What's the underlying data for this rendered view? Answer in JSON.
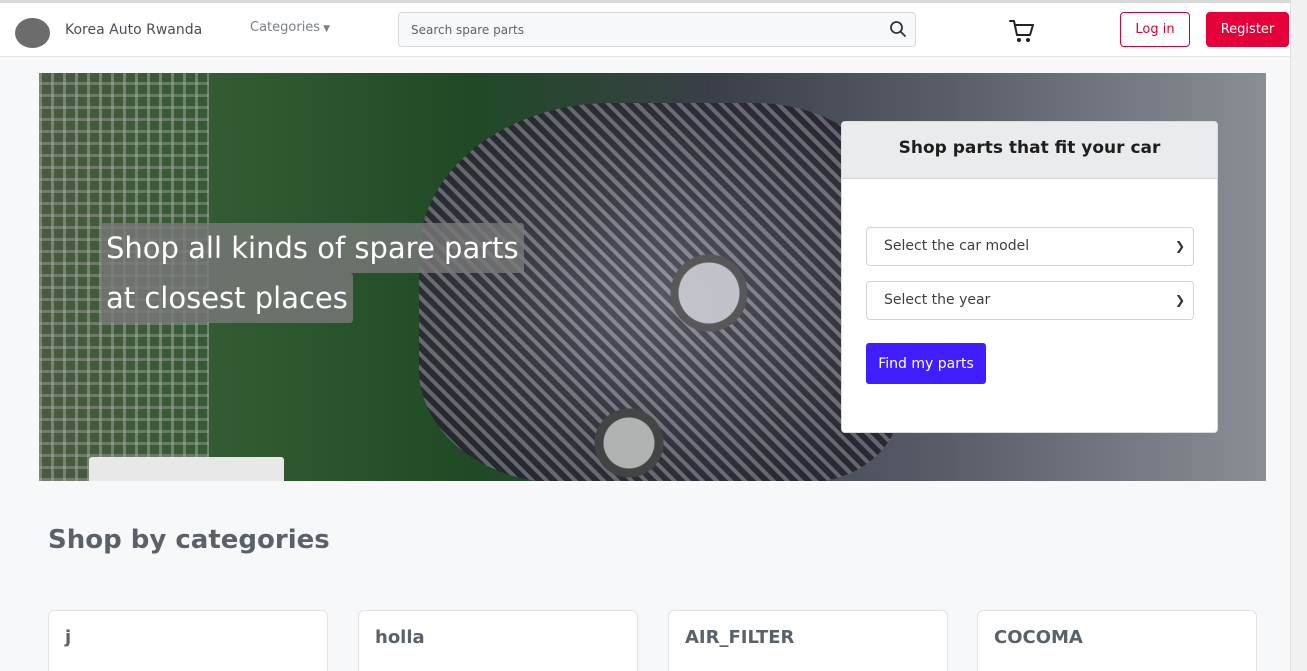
{
  "navbar": {
    "brand": "Korea Auto Rwanda",
    "categories_label": "Categories",
    "search_placeholder": "Search spare parts",
    "login_label": "Log in",
    "register_label": "Register",
    "icons": [
      "logo",
      "chevron-down-icon",
      "search-icon",
      "cart-icon"
    ]
  },
  "hero": {
    "line1": "Shop all kinds of spare parts",
    "line2": "at closest places"
  },
  "finder": {
    "title": "Shop parts that fit your car",
    "model_select": "Select the car model",
    "year_select": "Select the year",
    "button": "Find my parts"
  },
  "categories": {
    "title": "Shop by categories",
    "items": [
      {
        "name": "j"
      },
      {
        "name": "holla"
      },
      {
        "name": "AIR_FILTER"
      },
      {
        "name": "COCOMA"
      }
    ]
  },
  "colors": {
    "accent_red": "#e5003a",
    "find_button": "#3f1dff",
    "heading_gray": "#5b6169"
  }
}
